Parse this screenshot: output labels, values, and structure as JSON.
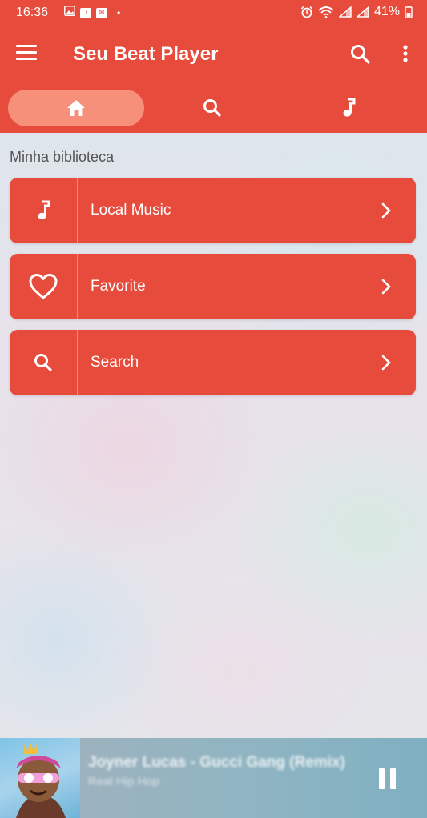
{
  "status_bar": {
    "time": "16:36",
    "battery": "41%",
    "icons": [
      "image-icon",
      "music-app-icon",
      "mail-icon",
      "dot-icon",
      "alarm-icon",
      "wifi-icon",
      "signal-icon",
      "signal-icon-2",
      "battery-icon"
    ]
  },
  "app_bar": {
    "title": "Seu Beat Player",
    "icons": [
      "menu-icon",
      "search-icon",
      "more-vert-icon"
    ]
  },
  "tabs": [
    {
      "icon": "home-icon",
      "active": true
    },
    {
      "icon": "search-icon",
      "active": false
    },
    {
      "icon": "music-note-icon",
      "active": false
    }
  ],
  "library": {
    "section_title": "Minha biblioteca",
    "items": [
      {
        "label": "Local Music",
        "icon": "music-note-icon"
      },
      {
        "label": "Favorite",
        "icon": "heart-icon"
      },
      {
        "label": "Search",
        "icon": "search-icon"
      }
    ]
  },
  "mini_player": {
    "song": "Joyner Lucas - Gucci Gang (Remix)",
    "genre": "Real Hip Hop",
    "state": "playing"
  },
  "colors": {
    "primary": "#e64b3c",
    "tab_active": "#f6907a"
  }
}
